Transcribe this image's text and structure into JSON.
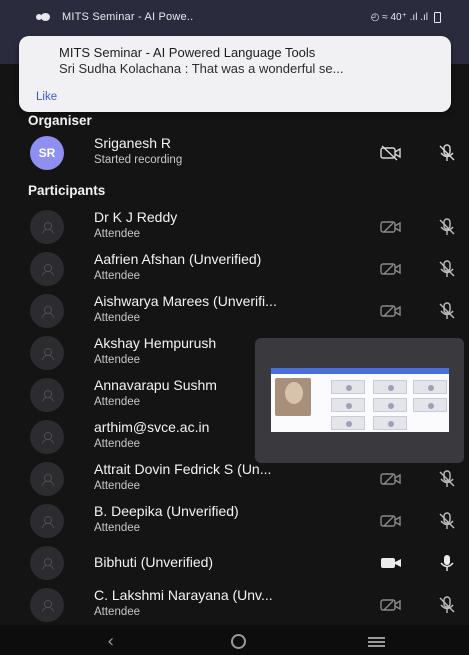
{
  "status_bar": {
    "title": "MITS Seminar - AI Powe..",
    "indicators": "◴ ≈ 40⁺ .ıl .ıl"
  },
  "notification": {
    "title": "MITS Seminar - AI Powered Language Tools",
    "body": "Sri Sudha Kolachana : That was a wonderful se...",
    "action": "Like"
  },
  "organiser": {
    "header": "Organiser",
    "initials": "SR",
    "name": "Sriganesh R",
    "status": "Started recording"
  },
  "participants": {
    "header": "Participants",
    "items": [
      {
        "name": "Dr K J Reddy",
        "role": "Attendee",
        "camera": "off",
        "mic": "off"
      },
      {
        "name": "Aafrien Afshan  (Unverified)",
        "role": "Attendee",
        "camera": "off",
        "mic": "off"
      },
      {
        "name": "Aishwarya Marees (Unverifi...",
        "role": "Attendee",
        "camera": "off",
        "mic": "off"
      },
      {
        "name": "Akshay Hempurush",
        "role": "Attendee",
        "camera": "off",
        "mic": "off"
      },
      {
        "name": "Annavarapu Sushm",
        "role": "Attendee",
        "camera": "off",
        "mic": "off"
      },
      {
        "name": "arthim@svce.ac.in",
        "role": "Attendee",
        "camera": "off",
        "mic": "off"
      },
      {
        "name": "Attrait Dovin Fedrick S  (Un...",
        "role": "Attendee",
        "camera": "off",
        "mic": "off"
      },
      {
        "name": "B. Deepika  (Unverified)",
        "role": "Attendee",
        "camera": "off",
        "mic": "off"
      },
      {
        "name": "Bibhuti (Unverified)",
        "role": "",
        "camera": "on",
        "mic": "on"
      },
      {
        "name": "C. Lakshmi Narayana  (Unv...",
        "role": "Attendee",
        "camera": "off",
        "mic": "off"
      }
    ]
  },
  "icons": {
    "camera_off": "video-off-icon",
    "camera_on": "video-icon",
    "mic_off": "mic-off-icon",
    "mic_on": "mic-icon"
  },
  "colors": {
    "background": "#141414",
    "status_bar": "#2a2c3e",
    "avatar_accent": "#8e8ff0",
    "link": "#3d57c9"
  }
}
